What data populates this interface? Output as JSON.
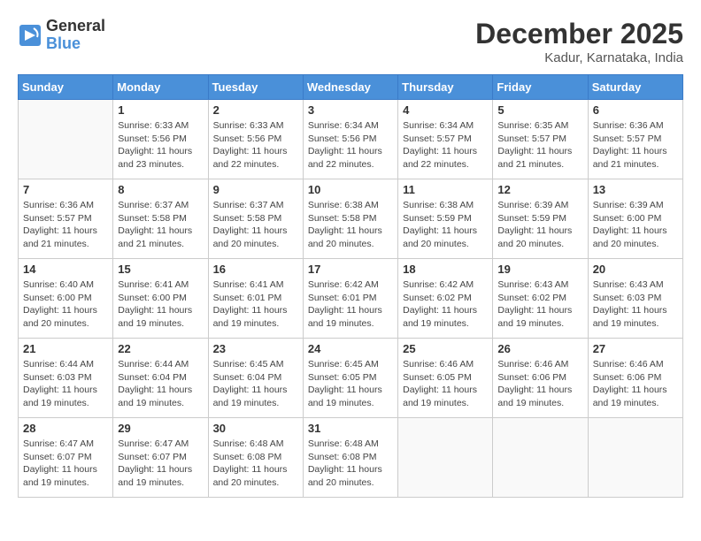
{
  "header": {
    "logo_general": "General",
    "logo_blue": "Blue",
    "month_title": "December 2025",
    "location": "Kadur, Karnataka, India"
  },
  "weekdays": [
    "Sunday",
    "Monday",
    "Tuesday",
    "Wednesday",
    "Thursday",
    "Friday",
    "Saturday"
  ],
  "weeks": [
    [
      {
        "day": "",
        "sunrise": "",
        "sunset": "",
        "daylight": ""
      },
      {
        "day": "1",
        "sunrise": "Sunrise: 6:33 AM",
        "sunset": "Sunset: 5:56 PM",
        "daylight": "Daylight: 11 hours and 23 minutes."
      },
      {
        "day": "2",
        "sunrise": "Sunrise: 6:33 AM",
        "sunset": "Sunset: 5:56 PM",
        "daylight": "Daylight: 11 hours and 22 minutes."
      },
      {
        "day": "3",
        "sunrise": "Sunrise: 6:34 AM",
        "sunset": "Sunset: 5:56 PM",
        "daylight": "Daylight: 11 hours and 22 minutes."
      },
      {
        "day": "4",
        "sunrise": "Sunrise: 6:34 AM",
        "sunset": "Sunset: 5:57 PM",
        "daylight": "Daylight: 11 hours and 22 minutes."
      },
      {
        "day": "5",
        "sunrise": "Sunrise: 6:35 AM",
        "sunset": "Sunset: 5:57 PM",
        "daylight": "Daylight: 11 hours and 21 minutes."
      },
      {
        "day": "6",
        "sunrise": "Sunrise: 6:36 AM",
        "sunset": "Sunset: 5:57 PM",
        "daylight": "Daylight: 11 hours and 21 minutes."
      }
    ],
    [
      {
        "day": "7",
        "sunrise": "Sunrise: 6:36 AM",
        "sunset": "Sunset: 5:57 PM",
        "daylight": "Daylight: 11 hours and 21 minutes."
      },
      {
        "day": "8",
        "sunrise": "Sunrise: 6:37 AM",
        "sunset": "Sunset: 5:58 PM",
        "daylight": "Daylight: 11 hours and 21 minutes."
      },
      {
        "day": "9",
        "sunrise": "Sunrise: 6:37 AM",
        "sunset": "Sunset: 5:58 PM",
        "daylight": "Daylight: 11 hours and 20 minutes."
      },
      {
        "day": "10",
        "sunrise": "Sunrise: 6:38 AM",
        "sunset": "Sunset: 5:58 PM",
        "daylight": "Daylight: 11 hours and 20 minutes."
      },
      {
        "day": "11",
        "sunrise": "Sunrise: 6:38 AM",
        "sunset": "Sunset: 5:59 PM",
        "daylight": "Daylight: 11 hours and 20 minutes."
      },
      {
        "day": "12",
        "sunrise": "Sunrise: 6:39 AM",
        "sunset": "Sunset: 5:59 PM",
        "daylight": "Daylight: 11 hours and 20 minutes."
      },
      {
        "day": "13",
        "sunrise": "Sunrise: 6:39 AM",
        "sunset": "Sunset: 6:00 PM",
        "daylight": "Daylight: 11 hours and 20 minutes."
      }
    ],
    [
      {
        "day": "14",
        "sunrise": "Sunrise: 6:40 AM",
        "sunset": "Sunset: 6:00 PM",
        "daylight": "Daylight: 11 hours and 20 minutes."
      },
      {
        "day": "15",
        "sunrise": "Sunrise: 6:41 AM",
        "sunset": "Sunset: 6:00 PM",
        "daylight": "Daylight: 11 hours and 19 minutes."
      },
      {
        "day": "16",
        "sunrise": "Sunrise: 6:41 AM",
        "sunset": "Sunset: 6:01 PM",
        "daylight": "Daylight: 11 hours and 19 minutes."
      },
      {
        "day": "17",
        "sunrise": "Sunrise: 6:42 AM",
        "sunset": "Sunset: 6:01 PM",
        "daylight": "Daylight: 11 hours and 19 minutes."
      },
      {
        "day": "18",
        "sunrise": "Sunrise: 6:42 AM",
        "sunset": "Sunset: 6:02 PM",
        "daylight": "Daylight: 11 hours and 19 minutes."
      },
      {
        "day": "19",
        "sunrise": "Sunrise: 6:43 AM",
        "sunset": "Sunset: 6:02 PM",
        "daylight": "Daylight: 11 hours and 19 minutes."
      },
      {
        "day": "20",
        "sunrise": "Sunrise: 6:43 AM",
        "sunset": "Sunset: 6:03 PM",
        "daylight": "Daylight: 11 hours and 19 minutes."
      }
    ],
    [
      {
        "day": "21",
        "sunrise": "Sunrise: 6:44 AM",
        "sunset": "Sunset: 6:03 PM",
        "daylight": "Daylight: 11 hours and 19 minutes."
      },
      {
        "day": "22",
        "sunrise": "Sunrise: 6:44 AM",
        "sunset": "Sunset: 6:04 PM",
        "daylight": "Daylight: 11 hours and 19 minutes."
      },
      {
        "day": "23",
        "sunrise": "Sunrise: 6:45 AM",
        "sunset": "Sunset: 6:04 PM",
        "daylight": "Daylight: 11 hours and 19 minutes."
      },
      {
        "day": "24",
        "sunrise": "Sunrise: 6:45 AM",
        "sunset": "Sunset: 6:05 PM",
        "daylight": "Daylight: 11 hours and 19 minutes."
      },
      {
        "day": "25",
        "sunrise": "Sunrise: 6:46 AM",
        "sunset": "Sunset: 6:05 PM",
        "daylight": "Daylight: 11 hours and 19 minutes."
      },
      {
        "day": "26",
        "sunrise": "Sunrise: 6:46 AM",
        "sunset": "Sunset: 6:06 PM",
        "daylight": "Daylight: 11 hours and 19 minutes."
      },
      {
        "day": "27",
        "sunrise": "Sunrise: 6:46 AM",
        "sunset": "Sunset: 6:06 PM",
        "daylight": "Daylight: 11 hours and 19 minutes."
      }
    ],
    [
      {
        "day": "28",
        "sunrise": "Sunrise: 6:47 AM",
        "sunset": "Sunset: 6:07 PM",
        "daylight": "Daylight: 11 hours and 19 minutes."
      },
      {
        "day": "29",
        "sunrise": "Sunrise: 6:47 AM",
        "sunset": "Sunset: 6:07 PM",
        "daylight": "Daylight: 11 hours and 19 minutes."
      },
      {
        "day": "30",
        "sunrise": "Sunrise: 6:48 AM",
        "sunset": "Sunset: 6:08 PM",
        "daylight": "Daylight: 11 hours and 20 minutes."
      },
      {
        "day": "31",
        "sunrise": "Sunrise: 6:48 AM",
        "sunset": "Sunset: 6:08 PM",
        "daylight": "Daylight: 11 hours and 20 minutes."
      },
      {
        "day": "",
        "sunrise": "",
        "sunset": "",
        "daylight": ""
      },
      {
        "day": "",
        "sunrise": "",
        "sunset": "",
        "daylight": ""
      },
      {
        "day": "",
        "sunrise": "",
        "sunset": "",
        "daylight": ""
      }
    ]
  ]
}
